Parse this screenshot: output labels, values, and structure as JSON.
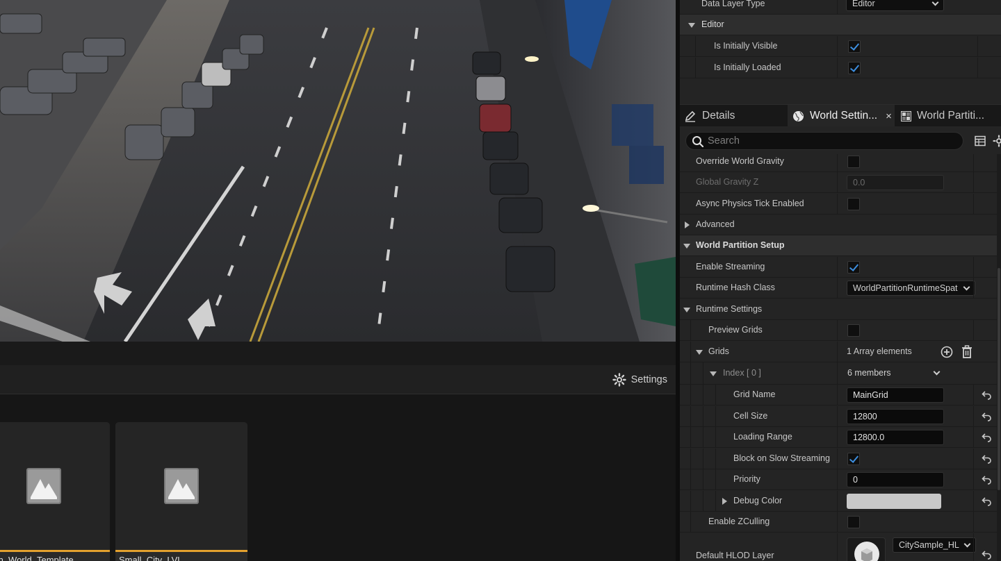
{
  "settings_button": {
    "label": "Settings"
  },
  "assets": [
    {
      "name": "Open_World_Template"
    },
    {
      "name": "Small_City_LVL"
    }
  ],
  "data_layer_panel": {
    "data_layer_type": {
      "label": "Data Layer Type",
      "value": "Editor"
    },
    "editor_section": {
      "label": "Editor"
    },
    "is_initially_visible": {
      "label": "Is Initially Visible",
      "checked": true
    },
    "is_initially_loaded": {
      "label": "Is Initially Loaded",
      "checked": true
    }
  },
  "tabs": [
    {
      "label": "Details",
      "icon": "pencil-icon",
      "active": false
    },
    {
      "label": "World Settin...",
      "icon": "globe-icon",
      "active": true,
      "close": "×"
    },
    {
      "label": "World Partiti...",
      "icon": "world-partition-icon",
      "active": false
    }
  ],
  "search": {
    "placeholder": "Search"
  },
  "details": {
    "override_world_gravity": {
      "label": "Override World Gravity",
      "checked": false
    },
    "global_gravity_z": {
      "label": "Global Gravity Z",
      "value": "0.0"
    },
    "async_physics_tick": {
      "label": "Async Physics Tick Enabled",
      "checked": false
    },
    "advanced": {
      "label": "Advanced"
    },
    "world_partition_setup": {
      "label": "World Partition Setup"
    },
    "enable_streaming": {
      "label": "Enable Streaming",
      "checked": true
    },
    "runtime_hash_class": {
      "label": "Runtime Hash Class",
      "value": "WorldPartitionRuntimeSpat"
    },
    "runtime_settings": {
      "label": "Runtime Settings"
    },
    "preview_grids": {
      "label": "Preview Grids",
      "checked": false
    },
    "grids": {
      "label": "Grids",
      "value": "1 Array elements"
    },
    "index": {
      "label": "Index [ 0 ]",
      "value": "6 members"
    },
    "grid_name": {
      "label": "Grid Name",
      "value": "MainGrid"
    },
    "cell_size": {
      "label": "Cell Size",
      "value": "12800"
    },
    "loading_range": {
      "label": "Loading Range",
      "value": "12800.0"
    },
    "block_on_slow_streaming": {
      "label": "Block on Slow Streaming",
      "checked": true
    },
    "priority": {
      "label": "Priority",
      "value": "0"
    },
    "debug_color": {
      "label": "Debug Color",
      "color": "#c8c8c8"
    },
    "enable_zculling": {
      "label": "Enable ZCulling",
      "checked": false
    },
    "default_hlod_layer": {
      "label": "Default HLOD Layer",
      "value": "CitySample_HL"
    }
  },
  "colors": {
    "accent_check": "#3d8fe0",
    "asset_bar": "#e3a12e",
    "panel_bg": "#242424"
  }
}
